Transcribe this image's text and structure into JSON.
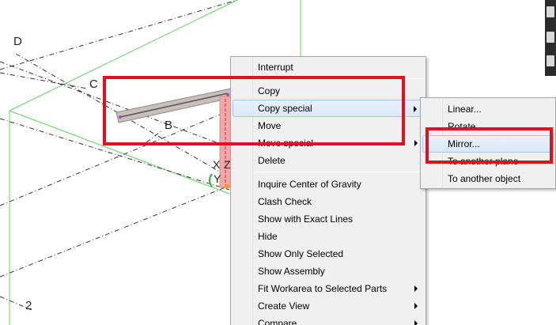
{
  "viewport": {
    "grid_labels": [
      "D",
      "C",
      "B",
      "2"
    ],
    "axis_labels": [
      "X",
      "Z",
      "Y"
    ]
  },
  "context_menu": {
    "items": [
      {
        "label": "Interrupt",
        "submenu": false
      },
      {
        "label": "Copy",
        "submenu": false
      },
      {
        "label": "Copy special",
        "submenu": true,
        "highlighted": true
      },
      {
        "label": "Move",
        "submenu": false
      },
      {
        "label": "Move special",
        "submenu": true
      },
      {
        "label": "Delete",
        "submenu": false
      },
      {
        "label": "Inquire Center of Gravity",
        "submenu": false
      },
      {
        "label": "Clash Check",
        "submenu": false
      },
      {
        "label": "Show with Exact Lines",
        "submenu": false
      },
      {
        "label": "Hide",
        "submenu": false
      },
      {
        "label": "Show Only Selected",
        "submenu": false
      },
      {
        "label": "Show Assembly",
        "submenu": false
      },
      {
        "label": "Fit Workarea to Selected Parts",
        "submenu": true
      },
      {
        "label": "Create View",
        "submenu": true
      },
      {
        "label": "Compare",
        "submenu": true
      }
    ]
  },
  "copy_special_submenu": {
    "items": [
      {
        "label": "Linear..."
      },
      {
        "label": "Rotate"
      },
      {
        "label": "Mirror...",
        "highlighted": true
      },
      {
        "label": "To another plane"
      },
      {
        "label": "To another object"
      }
    ]
  },
  "colors": {
    "annotation_red": "#e0101f",
    "menu_bg": "#f0f0f0",
    "highlight_border": "#a9c7ec"
  }
}
